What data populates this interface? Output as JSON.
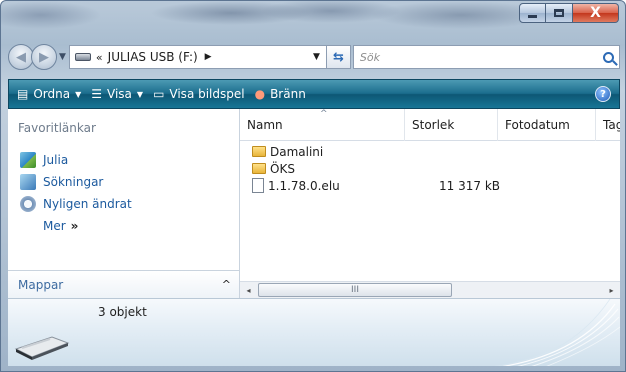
{
  "window": {
    "caption_buttons": {
      "minimize": "",
      "maximize": "",
      "close": "X"
    }
  },
  "address_bar": {
    "prefix": "«",
    "crumb": "JULIAS USB (F:)",
    "search_placeholder": "Sök"
  },
  "command_bar": {
    "items": [
      {
        "label": "Ordna",
        "icon": "organize-icon",
        "has_dropdown": true
      },
      {
        "label": "Visa",
        "icon": "views-icon",
        "has_dropdown": true
      },
      {
        "label": "Visa bildspel",
        "icon": "slideshow-icon",
        "has_dropdown": false
      },
      {
        "label": "Bränn",
        "icon": "burn-icon",
        "has_dropdown": false
      }
    ],
    "help_label": "?"
  },
  "nav_pane": {
    "favorites_header": "Favoritlänkar",
    "favorites": [
      {
        "label": "Julia",
        "icon": "user-folder-icon"
      },
      {
        "label": "Sökningar",
        "icon": "searches-icon"
      },
      {
        "label": "Nyligen ändrat",
        "icon": "recent-icon"
      }
    ],
    "more_label": "Mer",
    "more_chevron": "»",
    "folders_label": "Mappar",
    "folders_toggle": "^"
  },
  "file_list": {
    "columns": [
      "Namn",
      "Storlek",
      "Fotodatum",
      "Tag"
    ],
    "sort_indicator": "^",
    "rows": [
      {
        "name": "Damalini",
        "type": "folder",
        "size": ""
      },
      {
        "name": "ÖKS",
        "type": "folder",
        "size": ""
      },
      {
        "name": "1.1.78.0.elu",
        "type": "file",
        "size": "11 317 kB"
      }
    ],
    "scroll_grip": "III",
    "scroll_left": "◂",
    "scroll_right": "▸"
  },
  "details_pane": {
    "item_count": "3 objekt"
  }
}
